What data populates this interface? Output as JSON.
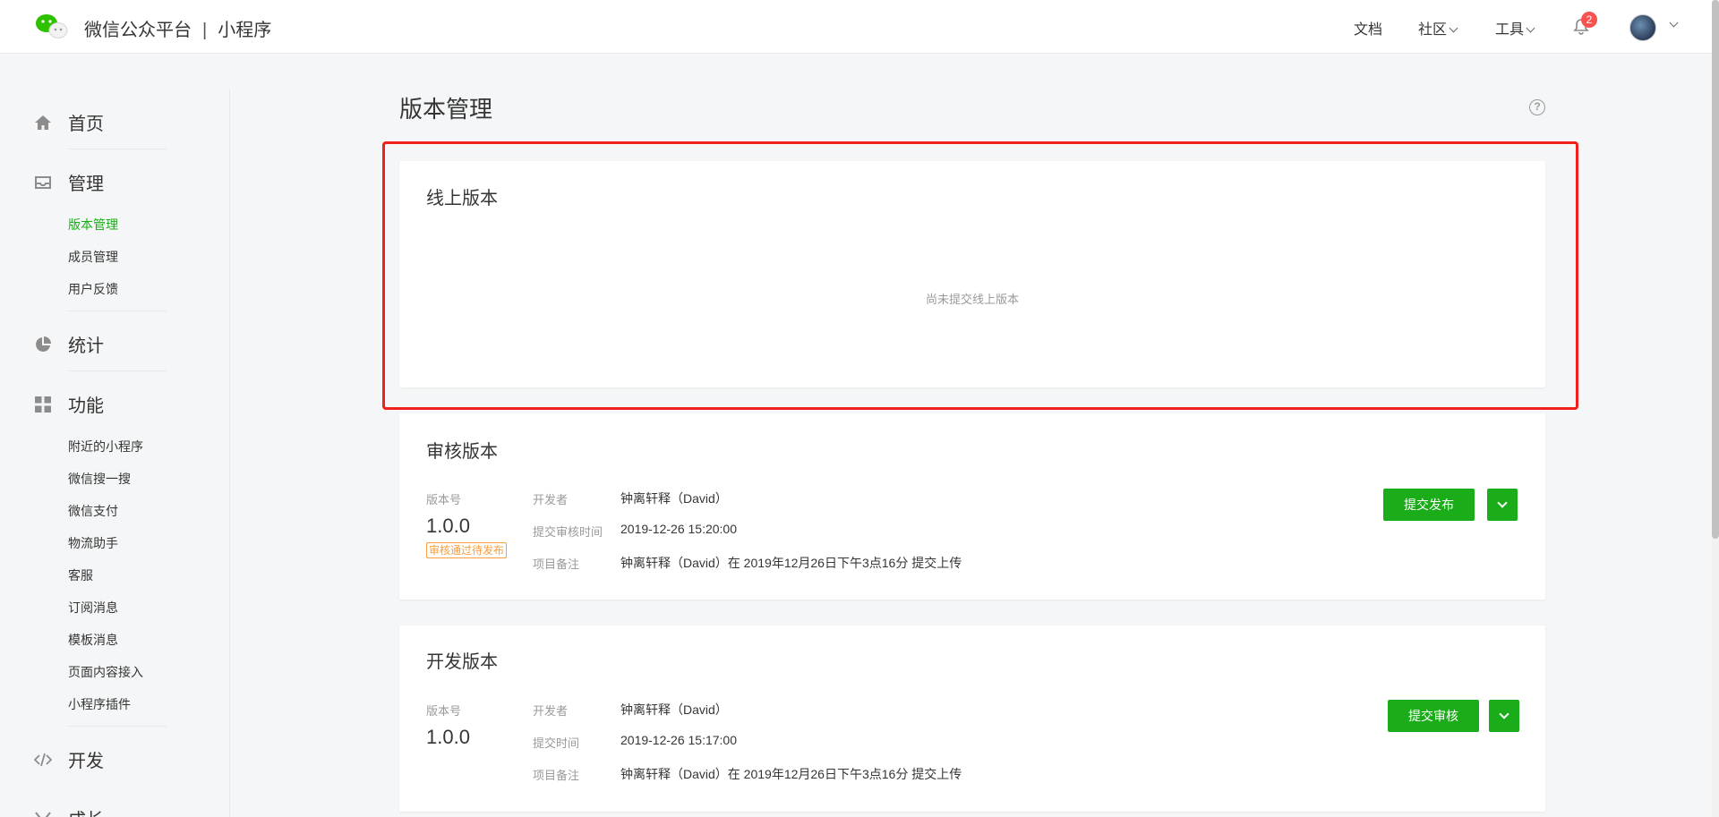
{
  "header": {
    "brand": "微信公众平台",
    "separator": "|",
    "product": "小程序",
    "nav": {
      "docs": "文档",
      "community": "社区",
      "tools": "工具"
    },
    "notification_count": "2"
  },
  "sidebar": {
    "home": "首页",
    "manage": {
      "label": "管理",
      "items": [
        "版本管理",
        "成员管理",
        "用户反馈"
      ]
    },
    "stats": "统计",
    "features": {
      "label": "功能",
      "items": [
        "附近的小程序",
        "微信搜一搜",
        "微信支付",
        "物流助手",
        "客服",
        "订阅消息",
        "模板消息",
        "页面内容接入",
        "小程序插件"
      ]
    },
    "develop": "开发",
    "growth": "成长"
  },
  "main": {
    "title": "版本管理",
    "online": {
      "title": "线上版本",
      "empty": "尚未提交线上版本"
    },
    "review": {
      "title": "审核版本",
      "version_label": "版本号",
      "version": "1.0.0",
      "status": "审核通过待发布",
      "developer_label": "开发者",
      "developer": "钟离轩释（David）",
      "time_label": "提交审核时间",
      "time": "2019-12-26 15:20:00",
      "note_label": "项目备注",
      "note": "钟离轩释（David）在 2019年12月26日下午3点16分 提交上传",
      "action": "提交发布"
    },
    "dev": {
      "title": "开发版本",
      "version_label": "版本号",
      "version": "1.0.0",
      "developer_label": "开发者",
      "developer": "钟离轩释（David）",
      "time_label": "提交时间",
      "time": "2019-12-26 15:17:00",
      "note_label": "项目备注",
      "note": "钟离轩释（David）在 2019年12月26日下午3点16分 提交上传",
      "action": "提交审核"
    }
  },
  "colors": {
    "accent": "#1aad19",
    "highlight": "#f21d1d",
    "warning": "#fa9d3b",
    "badge": "#fa5151"
  }
}
